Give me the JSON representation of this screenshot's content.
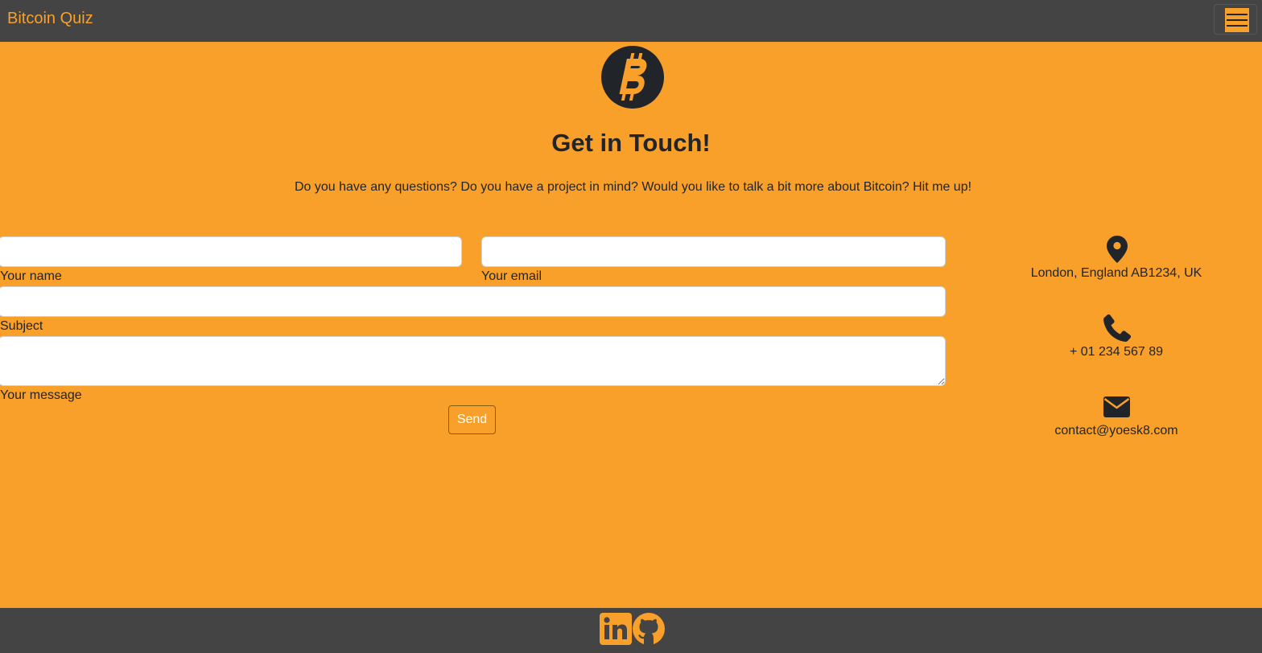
{
  "navbar": {
    "brand": "Bitcoin Quiz",
    "menu_icon": "hamburger-menu-icon"
  },
  "logo_icon": "bitcoin-logo-icon",
  "header": {
    "title": "Get in Touch!",
    "intro": "Do you have any questions? Do you have a project in mind? Would you like to talk a bit more about Bitcoin? Hit me up!"
  },
  "form": {
    "name": {
      "label": "Your name",
      "value": ""
    },
    "email": {
      "label": "Your email",
      "value": ""
    },
    "subject": {
      "label": "Subject",
      "value": ""
    },
    "message": {
      "label": "Your message",
      "value": ""
    },
    "send_label": "Send"
  },
  "contact": {
    "address": {
      "icon": "map-marker-icon",
      "text": "London, England AB1234, UK"
    },
    "phone": {
      "icon": "phone-icon",
      "text": "+ 01 234 567 89"
    },
    "email": {
      "icon": "envelope-icon",
      "text": "contact@yoesk8.com"
    }
  },
  "footer": {
    "links": [
      {
        "icon": "linkedin-icon"
      },
      {
        "icon": "github-icon"
      }
    ]
  },
  "colors": {
    "accent": "#f8a02a",
    "navbar": "#444444",
    "text": "#212529"
  }
}
